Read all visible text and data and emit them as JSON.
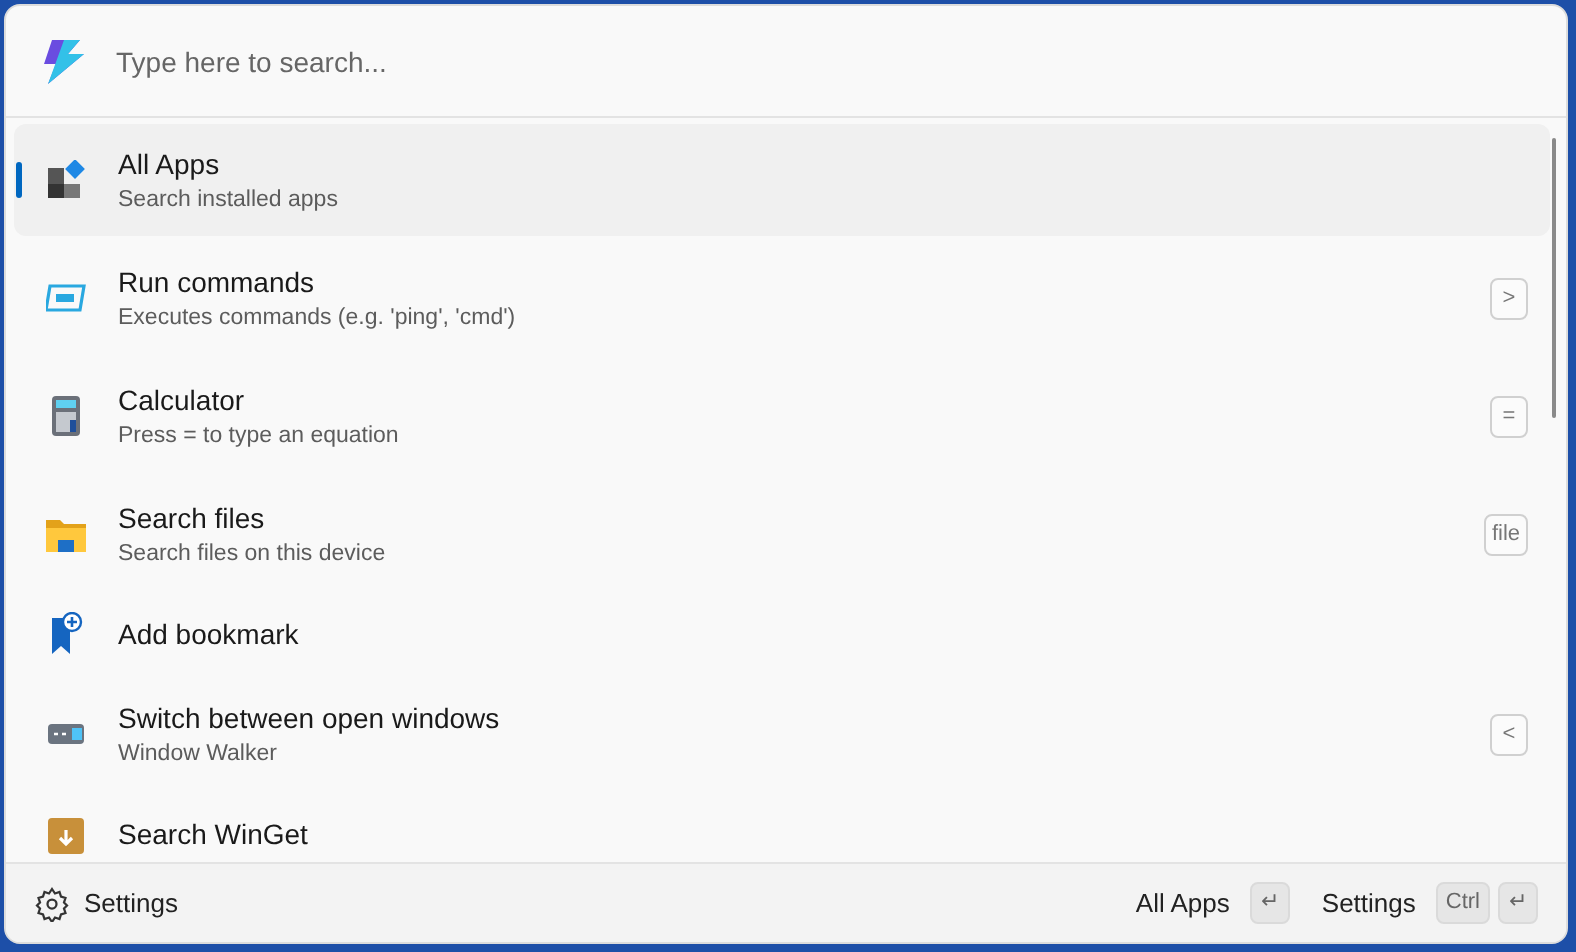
{
  "search": {
    "placeholder": "Type here to search..."
  },
  "items": [
    {
      "title": "All Apps",
      "subtitle": "Search installed apps",
      "selected": true
    },
    {
      "title": "Run commands",
      "subtitle": "Executes commands (e.g. 'ping', 'cmd')",
      "shortcut": ">",
      "selected": false
    },
    {
      "title": "Calculator",
      "subtitle": "Press = to type an equation",
      "shortcut": "=",
      "selected": false
    },
    {
      "title": "Search files",
      "subtitle": "Search files on this device",
      "shortcut": "file",
      "selected": false
    },
    {
      "title": "Add bookmark",
      "selected": false
    },
    {
      "title": "Switch between open windows",
      "subtitle": "Window Walker",
      "shortcut": "<",
      "selected": false
    },
    {
      "title": "Search WinGet",
      "selected": false
    }
  ],
  "footer": {
    "settings": "Settings",
    "actions": [
      {
        "label": "All Apps",
        "keys": [
          "↵"
        ]
      },
      {
        "label": "Settings",
        "keys": [
          "Ctrl",
          "↵"
        ]
      }
    ]
  }
}
